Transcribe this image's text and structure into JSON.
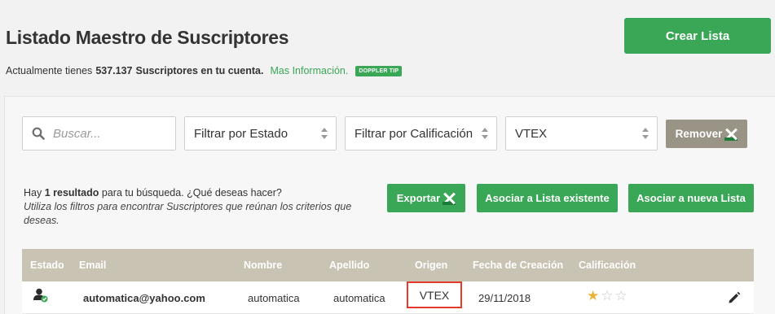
{
  "header": {
    "title": "Listado Maestro de Suscriptores",
    "create_label": "Crear Lista",
    "summary_prefix": "Actualmente tienes",
    "subscriber_count": "537.137",
    "summary_suffix": "Suscriptores en tu cuenta.",
    "more_info": "Mas Información.",
    "tip_badge": "DOPPLER TIP"
  },
  "filters": {
    "search_placeholder": "Buscar...",
    "state": "Filtrar por Estado",
    "rating": "Filtrar por Calificación",
    "origin": "VTEX",
    "remove_label": "Remover"
  },
  "results": {
    "prefix": "Hay",
    "count": "1 resultado",
    "suffix": "para tu búsqueda. ¿Qué deseas hacer?",
    "hint": "Utiliza los filtros para encontrar Suscriptores que reúnan los criterios que deseas.",
    "export_label": "Exportar",
    "assoc_existing_label": "Asociar a Lista existente",
    "assoc_new_label": "Asociar a nueva Lista"
  },
  "table": {
    "columns": [
      "Estado",
      "Email",
      "Nombre",
      "Apellido",
      "Origen",
      "Fecha de Creación",
      "Calificación"
    ],
    "rows": [
      {
        "email": "automatica@yahoo.com",
        "first_name": "automatica",
        "last_name": "automatica",
        "origin": "VTEX",
        "created": "29/11/2018",
        "rating": 1,
        "rating_max": 3,
        "status_icon": "subscriber-active-icon",
        "edit_icon": "pencil-icon"
      }
    ]
  },
  "colors": {
    "primary_green": "#3aa757",
    "table_header": "#c9c3b3",
    "remove_button": "#9a9486",
    "highlight_red": "#e53b2c",
    "star_on": "#e8b339"
  }
}
